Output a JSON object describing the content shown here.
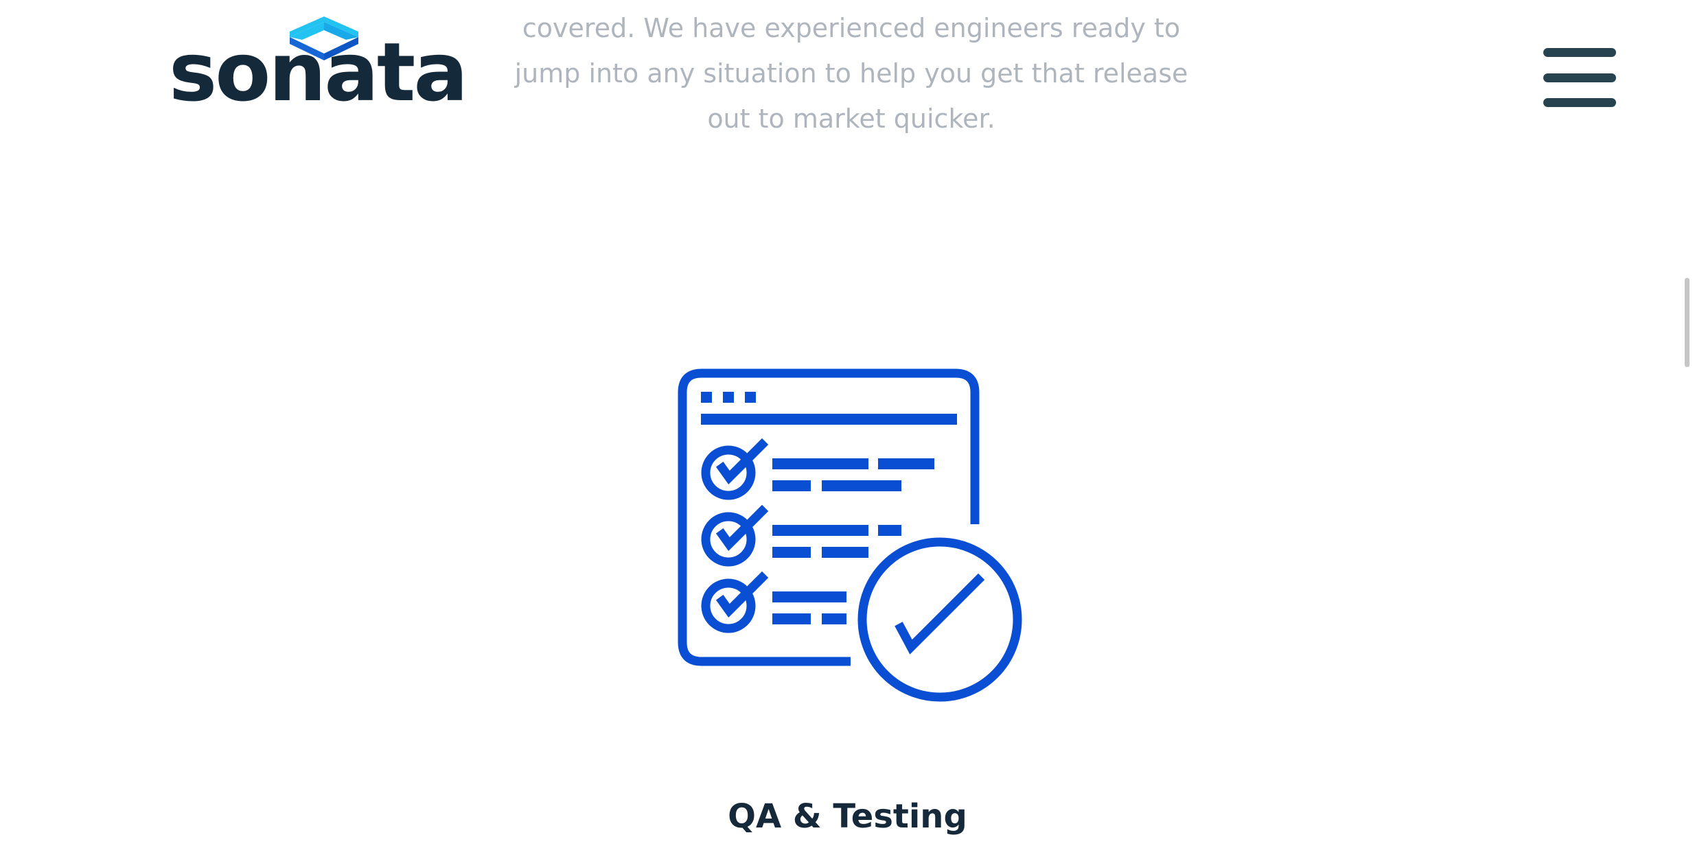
{
  "header": {
    "brand": {
      "name": "sonata",
      "mark_icon": "diamond-logo-icon",
      "mark_colors": [
        "#22c3f0",
        "#1666d6"
      ],
      "text_color": "#14293a"
    },
    "menu_icon": "hamburger-menu-icon",
    "menu_color": "#27434f"
  },
  "intro": {
    "lines": [
      "covered. We have experienced engineers ready to",
      "jump into any situation to help you get that release",
      "out to market quicker."
    ]
  },
  "service": {
    "icon": "qa-checklist-icon",
    "icon_color": "#0a4fd3",
    "title": "QA & Testing"
  }
}
